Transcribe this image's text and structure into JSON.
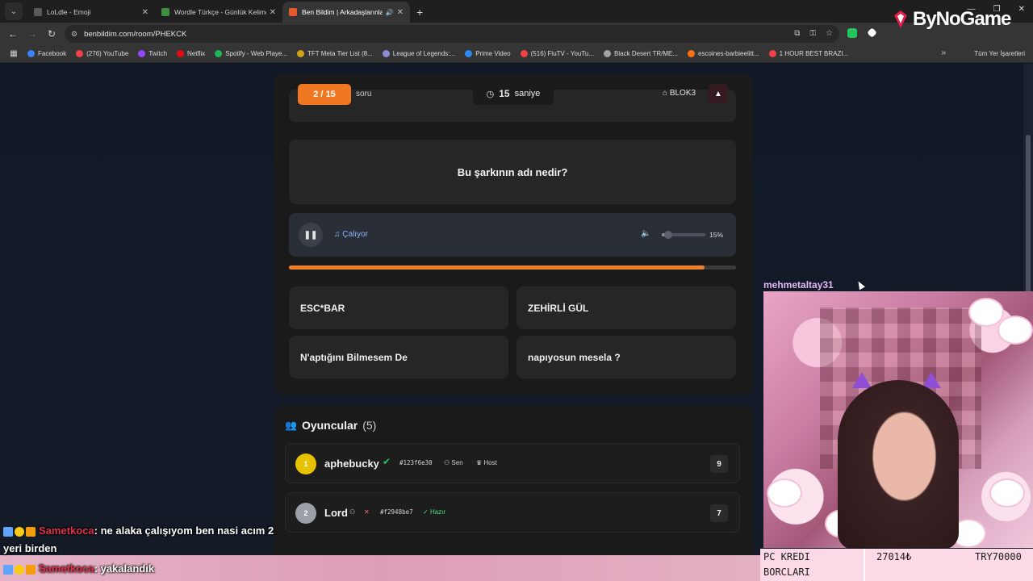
{
  "browser": {
    "tabs": [
      {
        "title": "LoLdle - Emoji",
        "color": "#3a3a3a"
      },
      {
        "title": "Wordle Türkçe - Günlük Kelime",
        "color": "#3e8f3e"
      },
      {
        "title": "Ben Bildim | Arkadaşlarınla",
        "color": "#e45a2a"
      }
    ],
    "url": "benbildim.com/room/PHEKCK",
    "bookmarks": [
      {
        "label": "Facebook",
        "color": "#3b82f6"
      },
      {
        "label": "(276) YouTube",
        "color": "#ef4444"
      },
      {
        "label": "Twitch",
        "color": "#9146ff"
      },
      {
        "label": "Netflix",
        "color": "#e50914"
      },
      {
        "label": "Spotify - Web Playe...",
        "color": "#1db954"
      },
      {
        "label": "TFT Meta Tier List (8...",
        "color": "#d4a017"
      },
      {
        "label": "League of Legends:...",
        "color": "#8b8bd6"
      },
      {
        "label": "Prime Video",
        "color": "#2d8cf0"
      },
      {
        "label": "(516) FluTV - YouTu...",
        "color": "#ef4444"
      },
      {
        "label": "Black Desert TR/ME...",
        "color": "#a3a3a3"
      },
      {
        "label": "escoines-barbieelitt...",
        "color": "#f97316"
      },
      {
        "label": "1 HOUR BEST BRAZI...",
        "color": "#ef4444"
      }
    ],
    "all_bookmarks": "Tüm Yer İşaretleri"
  },
  "game": {
    "question_counter": "2 / 15",
    "question_label": "soru",
    "timer_value": "15",
    "timer_unit": "saniye",
    "tag": "BLOK3",
    "question": "Bu şarkının adı nedir?",
    "player_status": "Çalıyor",
    "volume_percent": 15,
    "volume_label": "15%",
    "progress_fraction": 0.93,
    "answers": [
      "ESC*BAR",
      "ZEHİRLİ GÜL",
      "N'aptığını Bilmesem De",
      "napıyosun mesela ?"
    ]
  },
  "players": {
    "title": "Oyuncular",
    "count": "(5)",
    "list": [
      {
        "rank": "1",
        "name": "aphebucky",
        "code": "#123f6e30",
        "sen": "Sen",
        "host": "Host",
        "score": "9",
        "rank_color": "#e6c200"
      },
      {
        "rank": "2",
        "name": "Lord",
        "code": "#f2948be7",
        "ready": "Hazır",
        "score": "7",
        "rank_color": "#9aa0a6"
      }
    ]
  },
  "overlay": {
    "brand": "ByNoGame",
    "webcam_name": "mehmetaltay31",
    "kredi_line1": "PC KREDI",
    "kredi_line2": "BORCLARI",
    "kredi_value1": "27014₺",
    "kredi_value2": "TRY70000",
    "chat": [
      {
        "user": "Sametkoca",
        "message": ": ne alaka çalışıyom ben nasi acım 2",
        "cont": "yeri birden"
      },
      {
        "user": "Sametkoca",
        "message": ": yakalandık"
      }
    ]
  }
}
